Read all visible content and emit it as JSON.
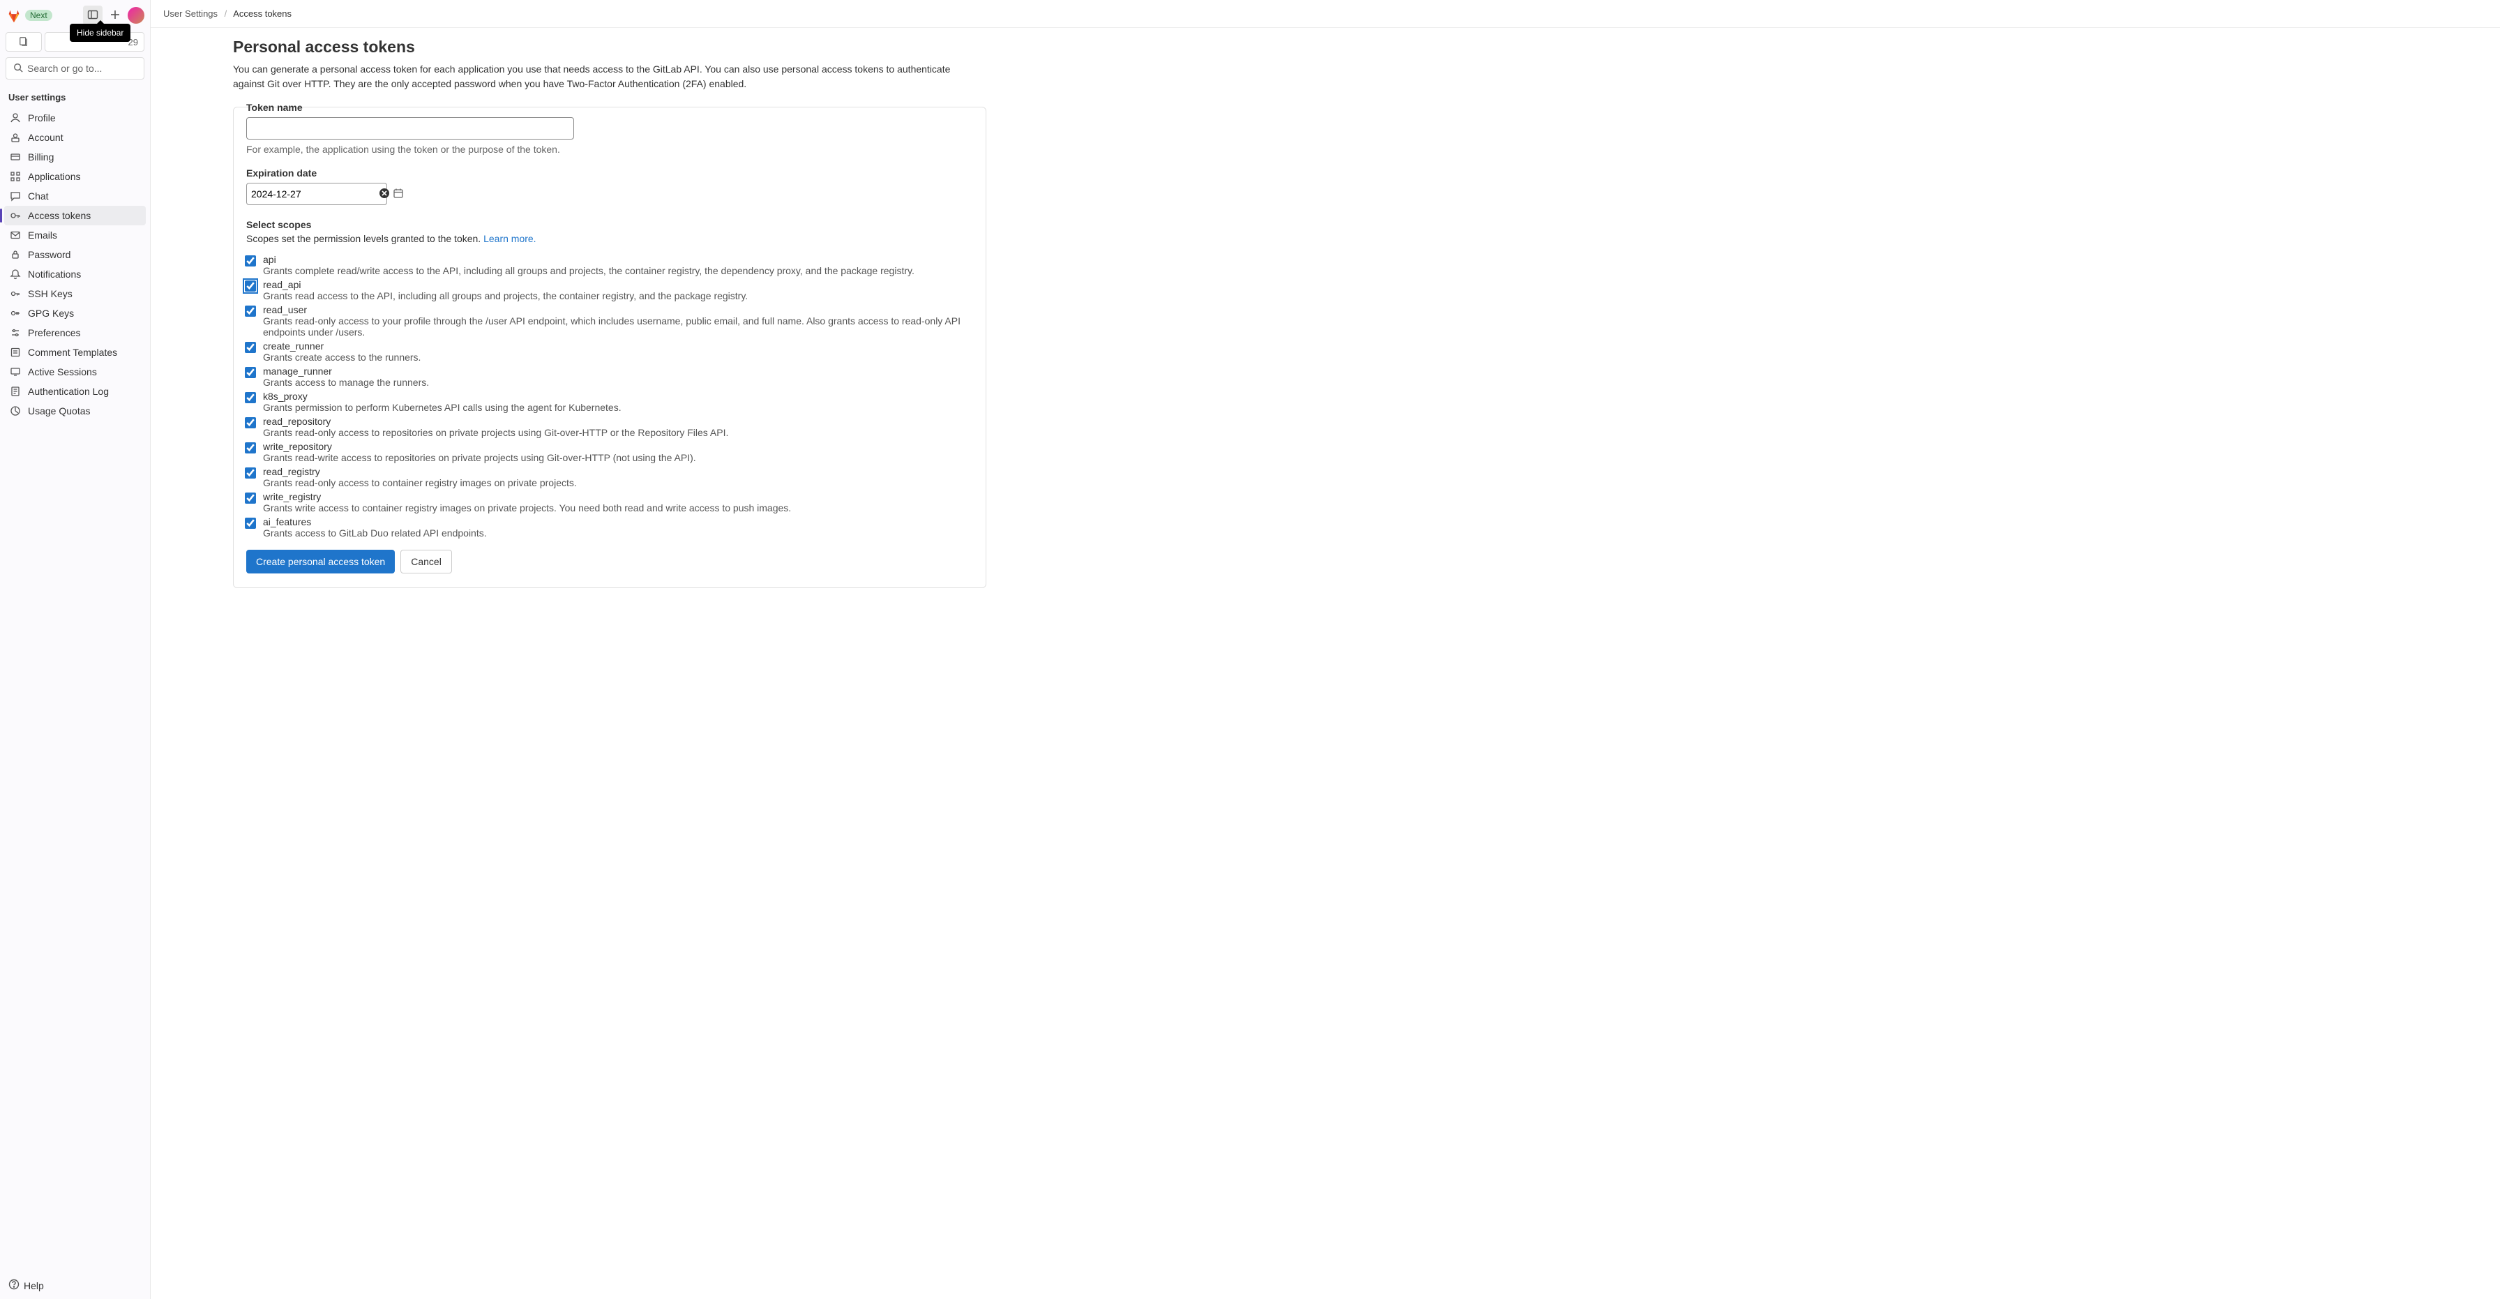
{
  "top": {
    "next_badge": "Next",
    "tooltip": "Hide sidebar",
    "counter": "29",
    "search_placeholder": "Search or go to..."
  },
  "sidebar": {
    "title": "User settings",
    "items": [
      {
        "label": "Profile",
        "icon": "profile"
      },
      {
        "label": "Account",
        "icon": "account"
      },
      {
        "label": "Billing",
        "icon": "billing"
      },
      {
        "label": "Applications",
        "icon": "applications"
      },
      {
        "label": "Chat",
        "icon": "chat"
      },
      {
        "label": "Access tokens",
        "icon": "token",
        "active": true
      },
      {
        "label": "Emails",
        "icon": "emails"
      },
      {
        "label": "Password",
        "icon": "password"
      },
      {
        "label": "Notifications",
        "icon": "notifications"
      },
      {
        "label": "SSH Keys",
        "icon": "sshkeys"
      },
      {
        "label": "GPG Keys",
        "icon": "gpgkeys"
      },
      {
        "label": "Preferences",
        "icon": "preferences"
      },
      {
        "label": "Comment Templates",
        "icon": "templates"
      },
      {
        "label": "Active Sessions",
        "icon": "sessions"
      },
      {
        "label": "Authentication Log",
        "icon": "authlog"
      },
      {
        "label": "Usage Quotas",
        "icon": "quotas"
      }
    ],
    "help": "Help"
  },
  "breadcrumbs": {
    "parent": "User Settings",
    "current": "Access tokens"
  },
  "page": {
    "title": "Personal access tokens",
    "description": "You can generate a personal access token for each application you use that needs access to the GitLab API. You can also use personal access tokens to authenticate against Git over HTTP. They are the only accepted password when you have Two-Factor Authentication (2FA) enabled."
  },
  "form": {
    "token_name_label": "Token name",
    "token_name_value": "",
    "token_name_help": "For example, the application using the token or the purpose of the token.",
    "expiration_label": "Expiration date",
    "expiration_value": "2024-12-27",
    "scopes_label": "Select scopes",
    "scopes_sub": "Scopes set the permission levels granted to the token. ",
    "learn_more": "Learn more.",
    "submit": "Create personal access token",
    "cancel": "Cancel",
    "scopes": [
      {
        "name": "api",
        "checked": true,
        "desc": "Grants complete read/write access to the API, including all groups and projects, the container registry, the dependency proxy, and the package registry."
      },
      {
        "name": "read_api",
        "checked": true,
        "focus": true,
        "desc": "Grants read access to the API, including all groups and projects, the container registry, and the package registry."
      },
      {
        "name": "read_user",
        "checked": true,
        "desc": "Grants read-only access to your profile through the /user API endpoint, which includes username, public email, and full name. Also grants access to read-only API endpoints under /users."
      },
      {
        "name": "create_runner",
        "checked": true,
        "desc": "Grants create access to the runners."
      },
      {
        "name": "manage_runner",
        "checked": true,
        "desc": "Grants access to manage the runners."
      },
      {
        "name": "k8s_proxy",
        "checked": true,
        "desc": "Grants permission to perform Kubernetes API calls using the agent for Kubernetes."
      },
      {
        "name": "read_repository",
        "checked": true,
        "desc": "Grants read-only access to repositories on private projects using Git-over-HTTP or the Repository Files API."
      },
      {
        "name": "write_repository",
        "checked": true,
        "desc": "Grants read-write access to repositories on private projects using Git-over-HTTP (not using the API)."
      },
      {
        "name": "read_registry",
        "checked": true,
        "desc": "Grants read-only access to container registry images on private projects."
      },
      {
        "name": "write_registry",
        "checked": true,
        "desc": "Grants write access to container registry images on private projects. You need both read and write access to push images."
      },
      {
        "name": "ai_features",
        "checked": true,
        "desc": "Grants access to GitLab Duo related API endpoints."
      }
    ]
  }
}
